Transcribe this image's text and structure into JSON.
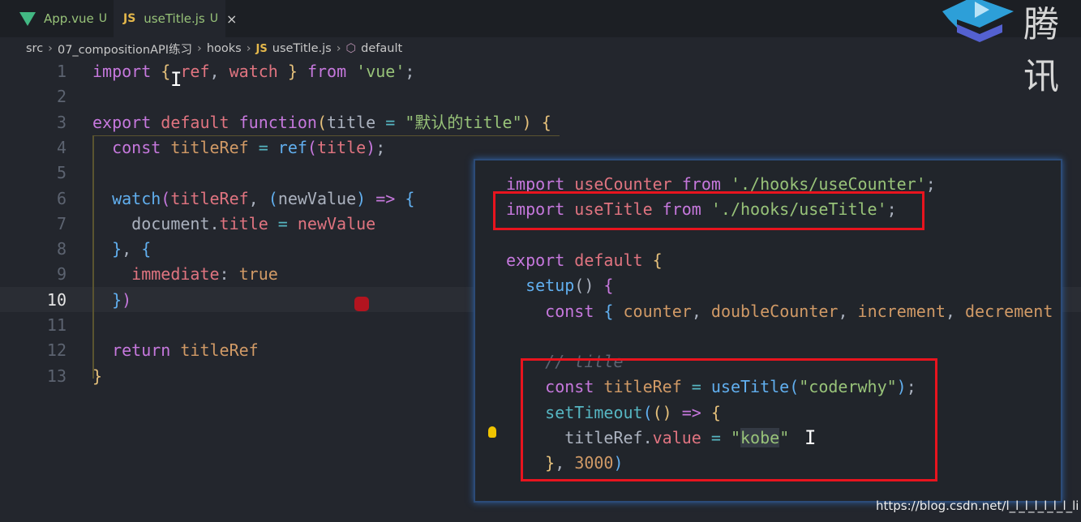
{
  "tabs": [
    {
      "label": "App.vue",
      "status": "U",
      "icon": "vue-icon"
    },
    {
      "label": "useTitle.js",
      "status": "U",
      "icon": "js-icon",
      "active": true,
      "close": "×"
    }
  ],
  "logo_text": "腾讯",
  "breadcrumb": [
    "src",
    "07_compositionAPI练习",
    "hooks",
    "useTitle.js",
    "default"
  ],
  "js_badge": "JS",
  "editor": {
    "current_line": 10,
    "lines": [
      [
        [
          "import ",
          "kw"
        ],
        [
          "{ ",
          "br"
        ],
        [
          "ref",
          "var"
        ],
        [
          ", ",
          "pl"
        ],
        [
          "watch",
          "var"
        ],
        [
          " } ",
          "br"
        ],
        [
          "from ",
          "kw"
        ],
        [
          "'vue'",
          "str"
        ],
        [
          ";",
          "pl"
        ]
      ],
      [],
      [
        [
          "export ",
          "kw"
        ],
        [
          "default ",
          "var"
        ],
        [
          "function",
          "kw"
        ],
        [
          "(",
          "br"
        ],
        [
          "title",
          "pl"
        ],
        [
          " = ",
          "op"
        ],
        [
          "\"默认的title\"",
          "str"
        ],
        [
          ") ",
          "br"
        ],
        [
          "{",
          "br"
        ]
      ],
      [
        [
          "  const ",
          "kw"
        ],
        [
          "titleRef",
          "pr"
        ],
        [
          " = ",
          "op"
        ],
        [
          "ref",
          "fn"
        ],
        [
          "(",
          "br2"
        ],
        [
          "title",
          "var"
        ],
        [
          ")",
          "br2"
        ],
        [
          ";",
          "pl"
        ]
      ],
      [],
      [
        [
          "  watch",
          "fn"
        ],
        [
          "(",
          "br2"
        ],
        [
          "titleRef",
          "var"
        ],
        [
          ", ",
          "pl"
        ],
        [
          "(",
          "br3"
        ],
        [
          "newValue",
          "pl"
        ],
        [
          ") ",
          "br3"
        ],
        [
          "=> ",
          "kw"
        ],
        [
          "{",
          "br3"
        ]
      ],
      [
        [
          "    document",
          "pl"
        ],
        [
          ".",
          "pl"
        ],
        [
          "title",
          "var"
        ],
        [
          " = ",
          "op"
        ],
        [
          "newValue",
          "var"
        ]
      ],
      [
        [
          "  }",
          "br3"
        ],
        [
          ", ",
          "pl"
        ],
        [
          "{",
          "br3"
        ]
      ],
      [
        [
          "    immediate",
          "var"
        ],
        [
          ": ",
          "pl"
        ],
        [
          "true",
          "num"
        ]
      ],
      [
        [
          "  }",
          "br3"
        ],
        [
          ")",
          "br2"
        ]
      ],
      [],
      [
        [
          "  return ",
          "kw"
        ],
        [
          "titleRef",
          "pr"
        ]
      ],
      [
        [
          "}",
          "br"
        ]
      ]
    ]
  },
  "overlay": {
    "lines": [
      [
        [
          "import ",
          "kw"
        ],
        [
          "useCounter ",
          "var"
        ],
        [
          "from ",
          "kw"
        ],
        [
          "'./hooks/useCounter'",
          "str"
        ],
        [
          ";",
          "pl"
        ]
      ],
      [
        [
          "import ",
          "kw"
        ],
        [
          "useTitle ",
          "var"
        ],
        [
          "from ",
          "kw"
        ],
        [
          "'./hooks/useTitle'",
          "str"
        ],
        [
          ";",
          "pl"
        ]
      ],
      [],
      [
        [
          "export ",
          "kw"
        ],
        [
          "default ",
          "var"
        ],
        [
          "{",
          "br"
        ]
      ],
      [
        [
          "  setup",
          "fn"
        ],
        [
          "() ",
          "pl"
        ],
        [
          "{",
          "br2"
        ]
      ],
      [
        [
          "    const ",
          "kw"
        ],
        [
          "{ ",
          "br3"
        ],
        [
          "counter",
          "pr"
        ],
        [
          ", ",
          "pl"
        ],
        [
          "doubleCounter",
          "pr"
        ],
        [
          ", ",
          "pl"
        ],
        [
          "increment",
          "pr"
        ],
        [
          ", ",
          "pl"
        ],
        [
          "decrement",
          "pr"
        ]
      ],
      [],
      [
        [
          "    // title",
          "cm"
        ]
      ],
      [
        [
          "    const ",
          "kw"
        ],
        [
          "titleRef",
          "pr"
        ],
        [
          " = ",
          "op"
        ],
        [
          "useTitle",
          "fn"
        ],
        [
          "(",
          "br3"
        ],
        [
          "\"coderwhy\"",
          "str"
        ],
        [
          ")",
          "br3"
        ],
        [
          ";",
          "pl"
        ]
      ],
      [
        [
          "    setTimeout",
          "op"
        ],
        [
          "(",
          "br3"
        ],
        [
          "()",
          "br"
        ],
        [
          " => ",
          "kw"
        ],
        [
          "{",
          "br"
        ]
      ],
      [
        [
          "      titleRef",
          "pl"
        ],
        [
          ".",
          "pl"
        ],
        [
          "value",
          "var"
        ],
        [
          " = ",
          "op"
        ],
        [
          "\"",
          "str"
        ],
        [
          "kobe",
          "str hl"
        ],
        [
          "\"",
          "str"
        ]
      ],
      [
        [
          "    }",
          "br"
        ],
        [
          ", ",
          "pl"
        ],
        [
          "3000",
          "num"
        ],
        [
          ")",
          "br3"
        ]
      ]
    ]
  },
  "watermark": "https://blog.csdn.net/l_l_l_l_l_l_l_li",
  "colors": {
    "background": "#23262d",
    "highlight_box": "#e8141e",
    "keyword": "#c678dd",
    "string": "#98c379"
  }
}
